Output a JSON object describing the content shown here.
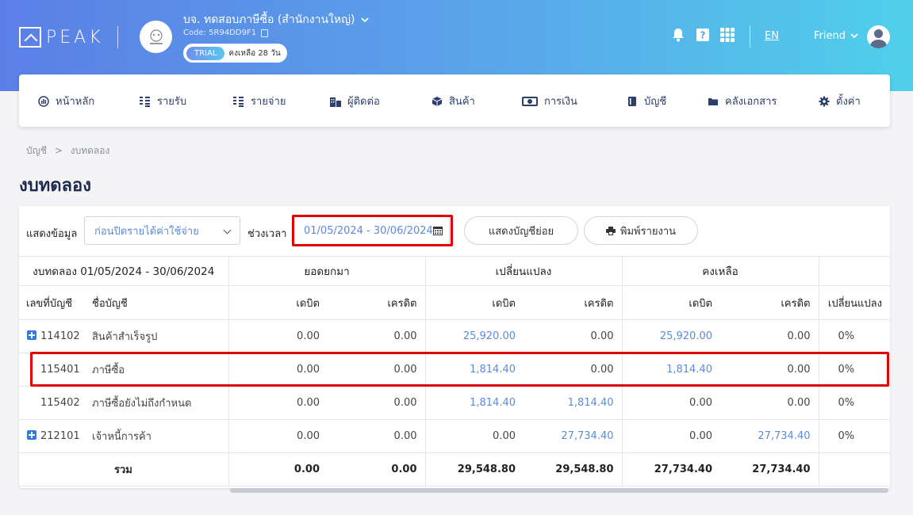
{
  "header": {
    "logo_text": "PEAK",
    "company_name": "บจ. ทดสอบภาษีซื้อ (สำนักงานใหญ่)",
    "company_code": "Code: 5R94DD9F1",
    "trial_badge": "TRIAL",
    "trial_remaining": "คงเหลือ 28 วัน",
    "language": "EN",
    "user_name": "Friend"
  },
  "nav": {
    "items": [
      {
        "label": "หน้าหลัก",
        "icon": "dashboard-icon"
      },
      {
        "label": "รายรับ",
        "icon": "income-icon"
      },
      {
        "label": "รายจ่าย",
        "icon": "expense-icon"
      },
      {
        "label": "ผู้ติดต่อ",
        "icon": "contacts-icon"
      },
      {
        "label": "สินค้า",
        "icon": "box-icon"
      },
      {
        "label": "การเงิน",
        "icon": "money-icon"
      },
      {
        "label": "บัญชี",
        "icon": "book-icon"
      },
      {
        "label": "คลังเอกสาร",
        "icon": "folder-icon"
      },
      {
        "label": "ตั้งค่า",
        "icon": "gear-icon"
      }
    ]
  },
  "breadcrumb": {
    "parent": "บัญชี",
    "separator": ">",
    "current": "งบทดลอง"
  },
  "page_title": "งบทดลอง",
  "filters": {
    "display_label": "แสดงข้อมูล",
    "display_value": "ก่อนปิดรายได้ค่าใช้จ่าย",
    "period_label": "ช่วงเวลา",
    "period_value": "01/05/2024 - 30/06/2024",
    "sub_accounts_button": "แสดงบัญชีย่อย",
    "print_button": "พิมพ์รายงาน"
  },
  "table": {
    "title": "งบทดลอง 01/05/2024 - 30/06/2024",
    "groups": [
      "ยอดยกมา",
      "เปลี่ยนแปลง",
      "คงเหลือ"
    ],
    "columns": {
      "account_no": "เลขที่บัญชี",
      "account_name": "ชื่อบัญชี",
      "debit": "เดบิต",
      "credit": "เครดิต",
      "change": "เปลี่ยนแปลง"
    },
    "rows": [
      {
        "no": "114102",
        "name": "สินค้าสำเร็จรูป",
        "expand": true,
        "ob_dr": "0.00",
        "ob_cr": "0.00",
        "ch_dr": "25,920.00",
        "ch_cr": "0.00",
        "bal_dr": "25,920.00",
        "bal_cr": "0.00",
        "pct": "0%"
      },
      {
        "no": "115401",
        "name": "ภาษีซื้อ",
        "expand": false,
        "ob_dr": "0.00",
        "ob_cr": "0.00",
        "ch_dr": "1,814.40",
        "ch_cr": "0.00",
        "bal_dr": "1,814.40",
        "bal_cr": "0.00",
        "pct": "0%"
      },
      {
        "no": "115402",
        "name": "ภาษีซื้อยังไม่ถึงกำหนด",
        "expand": false,
        "ob_dr": "0.00",
        "ob_cr": "0.00",
        "ch_dr": "1,814.40",
        "ch_cr": "1,814.40",
        "bal_dr": "0.00",
        "bal_cr": "0.00",
        "pct": "0%"
      },
      {
        "no": "212101",
        "name": "เจ้าหนี้การค้า",
        "expand": true,
        "ob_dr": "0.00",
        "ob_cr": "0.00",
        "ch_dr": "0.00",
        "ch_cr": "27,734.40",
        "bal_dr": "0.00",
        "bal_cr": "27,734.40",
        "pct": "0%"
      }
    ],
    "total": {
      "label": "รวม",
      "ob_dr": "0.00",
      "ob_cr": "0.00",
      "ch_dr": "29,548.80",
      "ch_cr": "29,548.80",
      "bal_dr": "27,734.40",
      "bal_cr": "27,734.40"
    }
  }
}
